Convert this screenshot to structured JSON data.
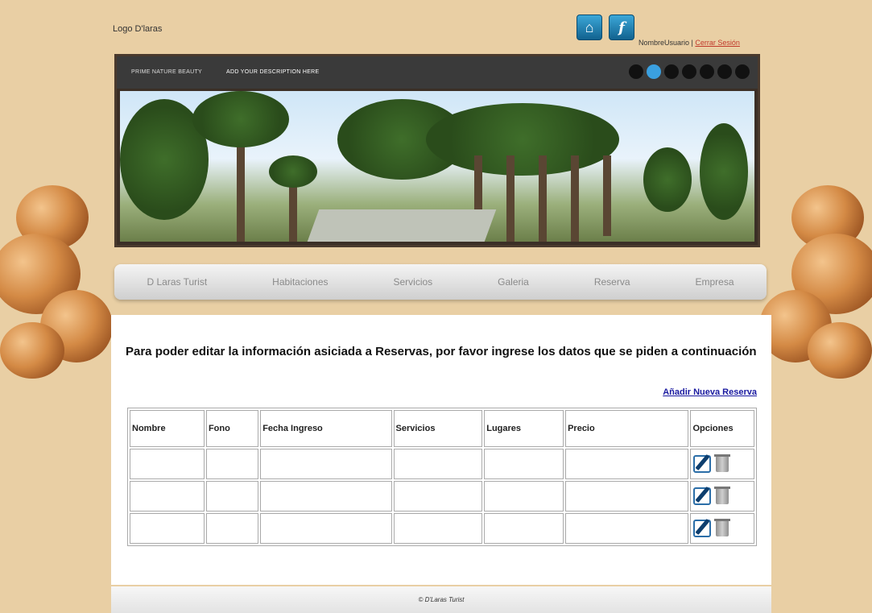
{
  "header": {
    "logo_text": "Logo D'laras",
    "username": "NombreUsuario",
    "separator": "|",
    "logout_label": "Cerrar Sesión"
  },
  "banner": {
    "title": "PRIME NATURE BEAUTY",
    "description": "ADD YOUR DESCRIPTION HERE",
    "slide_count": 7,
    "active_slide": 2
  },
  "nav": {
    "items": [
      {
        "label": "D Laras Turist"
      },
      {
        "label": "Habitaciones"
      },
      {
        "label": "Servicios"
      },
      {
        "label": "Galeria"
      },
      {
        "label": "Reserva"
      },
      {
        "label": "Empresa"
      }
    ]
  },
  "main": {
    "heading": "Para poder editar la información asiciada a Reservas, por favor ingrese los datos que se piden a continuación",
    "add_link": "Añadir Nueva Reserva",
    "table": {
      "columns": [
        "Nombre",
        "Fono",
        "Fecha Ingreso",
        "Servicios",
        "Lugares",
        "Precio",
        "Opciones"
      ],
      "rows": [
        {
          "cells": [
            "",
            "",
            "",
            "",
            "",
            ""
          ]
        },
        {
          "cells": [
            "",
            "",
            "",
            "",
            "",
            ""
          ]
        },
        {
          "cells": [
            "",
            "",
            "",
            "",
            "",
            ""
          ]
        }
      ]
    }
  },
  "footer": {
    "text": "© D'Laras Turist"
  },
  "icons": {
    "home": "home-icon",
    "flash": "flash-icon",
    "edit": "edit-icon",
    "delete": "trash-icon"
  },
  "colors": {
    "background": "#e9cfa4",
    "link": "#1a1aa0",
    "logout": "#c0392b",
    "active_dot": "#3aa0e0"
  }
}
